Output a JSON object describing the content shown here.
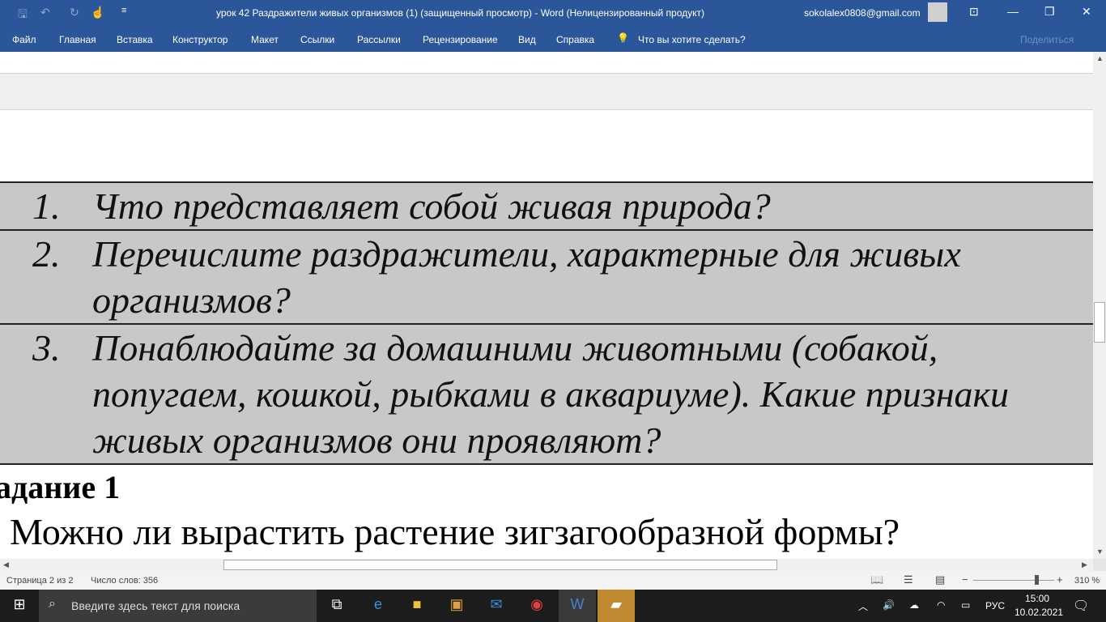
{
  "title": {
    "doc": "урок 42 Раздражители живых организмов (1) (защищенный просмотр)  -  Word (Нелицензированный продукт)",
    "account": "sokolalex0808@gmail.com"
  },
  "menu": [
    "Файл",
    "Главная",
    "Вставка",
    "Конструктор",
    "Макет",
    "Ссылки",
    "Рассылки",
    "Рецензирование",
    "Вид",
    "Справка"
  ],
  "tell_me": "Что вы хотите сделать?",
  "share": "Поделиться",
  "questions": [
    {
      "n": "1.",
      "text": "Что представляет собой живая природа?"
    },
    {
      "n": "2.",
      "text": "Перечислите раздражители, характерные для живых\nорганизмов?"
    },
    {
      "n": "3.",
      "text": "Понаблюдайте за домашними животными (собакой,\nпопугаем, кошкой, рыбками в аквариуме). Какие признаки\nживых организмов они проявляют?"
    }
  ],
  "heading": "адание 1",
  "paragraph": "Можно ли вырастить растение зигзагообразной формы?",
  "status": {
    "page": "Страница 2 из 2",
    "words": "Число слов: 356",
    "zoom": "310 %",
    "zoom_fraction": 0.78
  },
  "taskbar": {
    "search_placeholder": "Введите здесь текст для поиска",
    "lang": "РУС",
    "time": "15:00",
    "date": "10.02.2021"
  }
}
